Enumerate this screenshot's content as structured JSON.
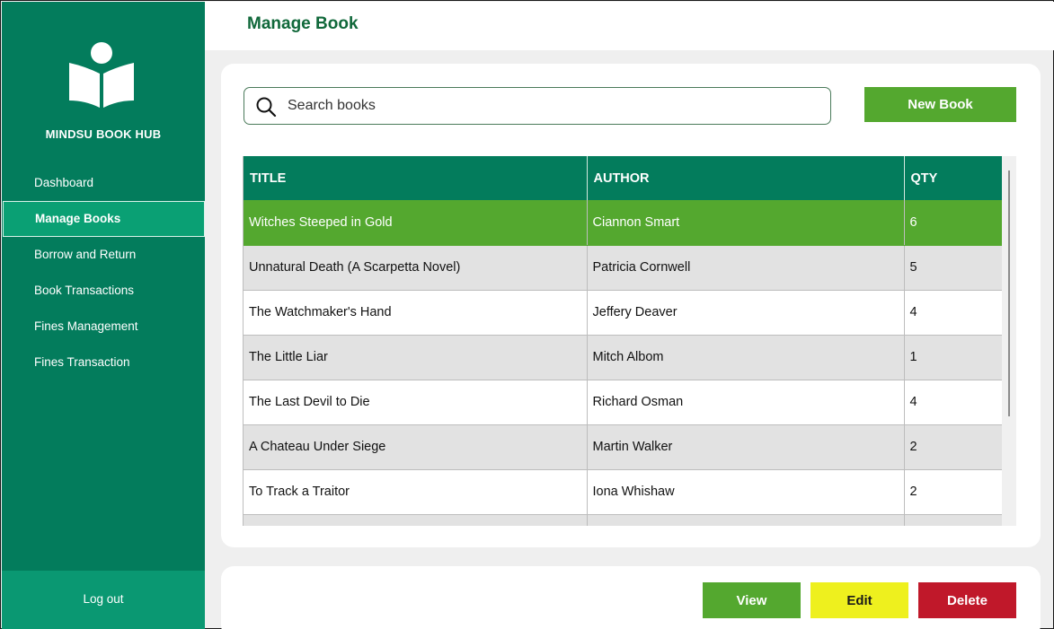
{
  "app": {
    "brand": "MINDSU BOOK HUB"
  },
  "header": {
    "title": "Manage Book"
  },
  "sidebar": {
    "items": [
      {
        "label": "Dashboard"
      },
      {
        "label": "Manage Books"
      },
      {
        "label": "Borrow and Return"
      },
      {
        "label": "Book Transactions"
      },
      {
        "label": "Fines Management"
      },
      {
        "label": "Fines Transaction"
      }
    ],
    "logout": "Log out",
    "logo_icon": "book-reader-icon"
  },
  "search": {
    "placeholder": "Search books",
    "value": "",
    "icon": "search-icon"
  },
  "toolbar": {
    "new_book": "New Book"
  },
  "table": {
    "headers": [
      "TITLE",
      "AUTHOR",
      "QTY"
    ],
    "rows": [
      [
        "Witches Steeped in Gold",
        "Ciannon Smart",
        "6"
      ],
      [
        "Unnatural Death (A Scarpetta Novel)",
        "Patricia Cornwell",
        "5"
      ],
      [
        "The Watchmaker's Hand",
        "Jeffery Deaver",
        "4"
      ],
      [
        "The Little Liar",
        "Mitch Albom",
        "1"
      ],
      [
        "The Last Devil to Die",
        "Richard Osman",
        "4"
      ],
      [
        "A Chateau Under Siege",
        "Martin Walker",
        "2"
      ],
      [
        "To Track a Traitor",
        "Iona Whishaw",
        "2"
      ],
      [
        "",
        "",
        ""
      ]
    ]
  },
  "actions": {
    "view": "View",
    "edit": "Edit",
    "delete": "Delete"
  },
  "colors": {
    "sidebar": "#037c5c",
    "accent_green": "#54a82f",
    "title_green": "#10683a",
    "edit_yellow": "#eef01e",
    "delete_red": "#c0182a"
  }
}
